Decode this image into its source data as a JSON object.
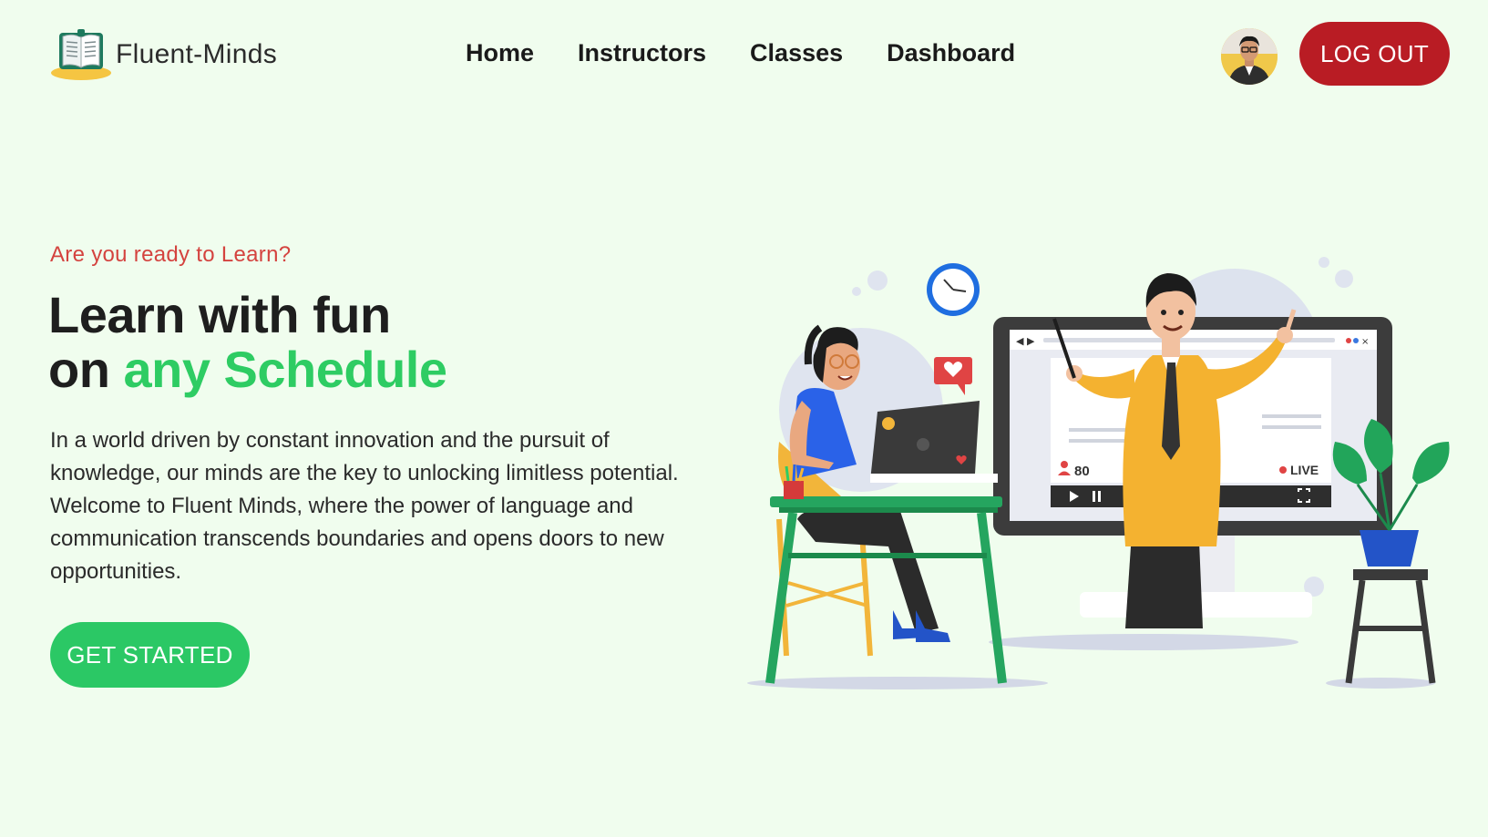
{
  "header": {
    "brand_name": "Fluent-Minds",
    "logo_icon": "open-book-logo-icon",
    "nav": [
      {
        "label": "Home"
      },
      {
        "label": "Instructors"
      },
      {
        "label": "Classes"
      },
      {
        "label": "Dashboard"
      }
    ],
    "avatar_icon": "user-avatar",
    "logout_label": "LOG OUT"
  },
  "hero": {
    "eyebrow": "Are you ready to Learn?",
    "headline_line1": "Learn with fun",
    "headline_line2_prefix": "on ",
    "headline_line2_accent": "any Schedule",
    "description": "In a world driven by constant innovation and the pursuit of knowledge, our minds are the key to unlocking limitless potential. Welcome to Fluent Minds, where the power of language and communication transcends boundaries and opens doors to new opportunities.",
    "cta_label": "GET STARTED"
  },
  "illustration": {
    "viewer_count": "80",
    "live_label": "LIVE",
    "icons": [
      "clock-icon",
      "heart-chat-icon",
      "play-icon",
      "pause-icon",
      "fullscreen-icon",
      "viewer-icon",
      "live-dot-icon"
    ]
  },
  "colors": {
    "background": "#f0fdee",
    "accent_green": "#2ecc63",
    "cta_green": "#2bc865",
    "logout_red": "#b91c24",
    "eyebrow_red": "#d4433f"
  }
}
